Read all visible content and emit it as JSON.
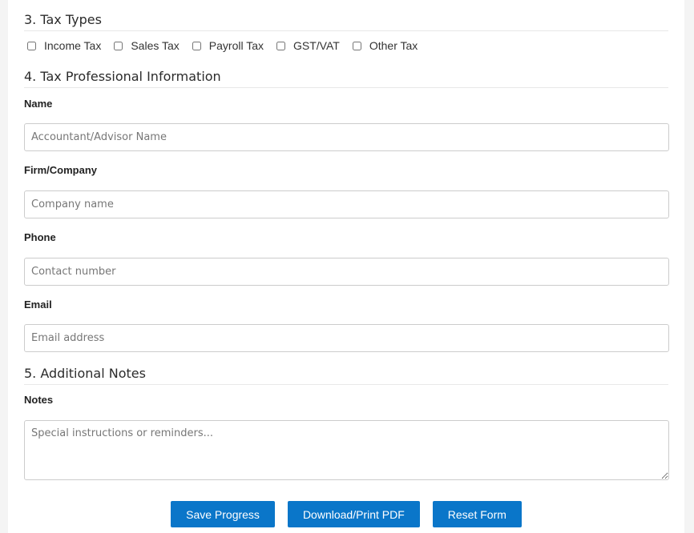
{
  "sections": {
    "tax_types": {
      "title": "3. Tax Types",
      "options": [
        "Income Tax",
        "Sales Tax",
        "Payroll Tax",
        "GST/VAT",
        "Other Tax"
      ]
    },
    "tax_professional": {
      "title": "4. Tax Professional Information",
      "fields": {
        "name": {
          "label": "Name",
          "placeholder": "Accountant/Advisor Name"
        },
        "firm": {
          "label": "Firm/Company",
          "placeholder": "Company name"
        },
        "phone": {
          "label": "Phone",
          "placeholder": "Contact number"
        },
        "email": {
          "label": "Email",
          "placeholder": "Email address"
        }
      }
    },
    "notes": {
      "title": "5. Additional Notes",
      "label": "Notes",
      "placeholder": "Special instructions or reminders..."
    }
  },
  "buttons": {
    "save": "Save Progress",
    "download": "Download/Print PDF",
    "reset": "Reset Form"
  },
  "colors": {
    "button_bg": "#0a76c9"
  }
}
